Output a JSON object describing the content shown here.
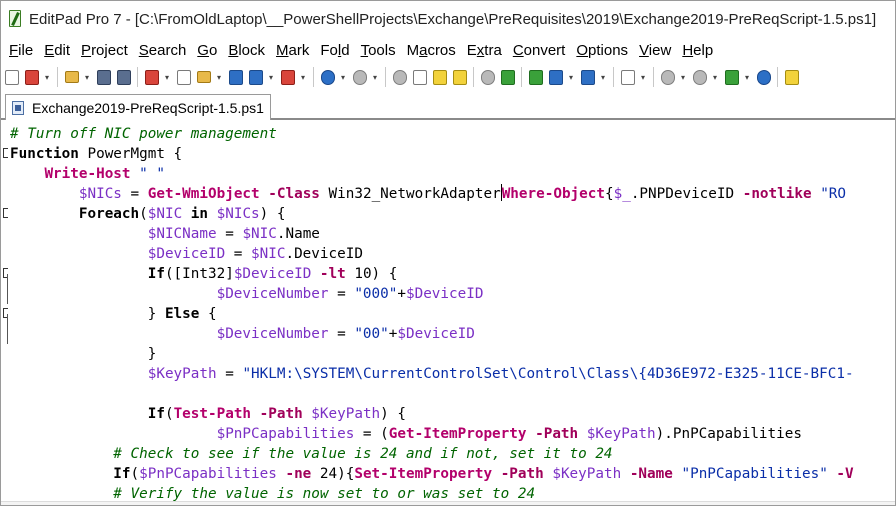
{
  "window": {
    "title": "EditPad Pro 7 - [C:\\FromOldLaptop\\__PowerShellProjects\\Exchange\\PreRequisites\\2019\\Exchange2019-PreReqScript-1.5.ps1]"
  },
  "menu": [
    {
      "first": "F",
      "rest": "ile"
    },
    {
      "first": "E",
      "rest": "dit"
    },
    {
      "first": "P",
      "rest": "roject"
    },
    {
      "first": "S",
      "rest": "earch"
    },
    {
      "first": "G",
      "rest": "o"
    },
    {
      "first": "B",
      "rest": "lock"
    },
    {
      "first": "M",
      "rest": "ark"
    },
    {
      "first": "Fo",
      "rest": "ld",
      "u": "l"
    },
    {
      "first": "T",
      "rest": "ools"
    },
    {
      "first": "M",
      "rest": "acros",
      "pre": "",
      "u2": "a"
    },
    {
      "first": "E",
      "rest": "xtra",
      "u": "x"
    },
    {
      "first": "C",
      "rest": "onvert"
    },
    {
      "first": "O",
      "rest": "ptions"
    },
    {
      "first": "V",
      "rest": "iew"
    },
    {
      "first": "H",
      "rest": "elp"
    }
  ],
  "menu_labels": [
    "File",
    "Edit",
    "Project",
    "Search",
    "Go",
    "Block",
    "Mark",
    "Fold",
    "Tools",
    "Macros",
    "Extra",
    "Convert",
    "Options",
    "View",
    "Help"
  ],
  "menu_underlines": [
    "F",
    "E",
    "P",
    "S",
    "G",
    "B",
    "M",
    "l",
    "T",
    "a",
    "x",
    "C",
    "O",
    "V",
    "H"
  ],
  "toolbar_icons": [
    "new-file-icon",
    "close-file-icon",
    "open-file-icon",
    "save-icon",
    "save-all-icon",
    "open-project-icon",
    "copy-files-icon",
    "folder-icon",
    "print-icon",
    "print-preview-icon",
    "delete-icon",
    "undo-icon",
    "redo-icon",
    "cut-icon",
    "copy-icon",
    "paste-icon",
    "clipboard-icon",
    "search-icon",
    "replace-icon",
    "indent-icon",
    "block-icon",
    "font-icon",
    "spellcheck-icon",
    "back-icon",
    "forward-icon",
    "bookmark-icon",
    "run-icon",
    "tools-icon"
  ],
  "tab": {
    "label": "Exchange2019-PreReqScript-1.5.ps1"
  },
  "code": [
    {
      "fold": "",
      "indent": "",
      "tokens": [
        [
          "comment",
          "# Turn off NIC power management"
        ]
      ]
    },
    {
      "fold": "box",
      "indent": "",
      "tokens": [
        [
          "kw",
          "Function"
        ],
        [
          "plain",
          " PowerMgmt {"
        ]
      ]
    },
    {
      "fold": "",
      "indent": "    ",
      "tokens": [
        [
          "cmd",
          "Write-Host"
        ],
        [
          "plain",
          " "
        ],
        [
          "str",
          "\" \""
        ]
      ]
    },
    {
      "fold": "",
      "indent": "        ",
      "tokens": [
        [
          "var",
          "$NICs"
        ],
        [
          "plain",
          " = "
        ],
        [
          "cmd",
          "Get-WmiObject"
        ],
        [
          "plain",
          " "
        ],
        [
          "op",
          "-Class"
        ],
        [
          "plain",
          " Win32_NetworkAdapter"
        ],
        [
          "caret",
          ""
        ],
        [
          "cmd",
          "Where-Object"
        ],
        [
          "plain",
          "{"
        ],
        [
          "var",
          "$_"
        ],
        [
          "plain",
          ".PNPDeviceID "
        ],
        [
          "op",
          "-notlike"
        ],
        [
          "plain",
          " "
        ],
        [
          "str",
          "\"RO"
        ]
      ]
    },
    {
      "fold": "box",
      "indent": "        ",
      "tokens": [
        [
          "kw",
          "Foreach"
        ],
        [
          "plain",
          "("
        ],
        [
          "var",
          "$NIC"
        ],
        [
          "plain",
          " "
        ],
        [
          "kw",
          "in"
        ],
        [
          "plain",
          " "
        ],
        [
          "var",
          "$NICs"
        ],
        [
          "plain",
          ") {"
        ]
      ]
    },
    {
      "fold": "",
      "indent": "                ",
      "tokens": [
        [
          "var",
          "$NICName"
        ],
        [
          "plain",
          " = "
        ],
        [
          "var",
          "$NIC"
        ],
        [
          "plain",
          ".Name"
        ]
      ]
    },
    {
      "fold": "",
      "indent": "                ",
      "tokens": [
        [
          "var",
          "$DeviceID"
        ],
        [
          "plain",
          " = "
        ],
        [
          "var",
          "$NIC"
        ],
        [
          "plain",
          ".DeviceID"
        ]
      ]
    },
    {
      "fold": "box",
      "indent": "                ",
      "tokens": [
        [
          "kw",
          "If"
        ],
        [
          "plain",
          "([Int32]"
        ],
        [
          "var",
          "$DeviceID"
        ],
        [
          "plain",
          " "
        ],
        [
          "op",
          "-lt"
        ],
        [
          "plain",
          " 10) {"
        ]
      ]
    },
    {
      "fold": "",
      "indent": "                        ",
      "tokens": [
        [
          "var",
          "$DeviceNumber"
        ],
        [
          "plain",
          " = "
        ],
        [
          "str",
          "\"000\""
        ],
        [
          "plain",
          "+"
        ],
        [
          "var",
          "$DeviceID"
        ]
      ]
    },
    {
      "fold": "box",
      "indent": "                ",
      "tokens": [
        [
          "plain",
          "} "
        ],
        [
          "kw",
          "Else"
        ],
        [
          "plain",
          " {"
        ]
      ]
    },
    {
      "fold": "",
      "indent": "                        ",
      "tokens": [
        [
          "var",
          "$DeviceNumber"
        ],
        [
          "plain",
          " = "
        ],
        [
          "str",
          "\"00\""
        ],
        [
          "plain",
          "+"
        ],
        [
          "var",
          "$DeviceID"
        ]
      ]
    },
    {
      "fold": "",
      "indent": "                ",
      "tokens": [
        [
          "plain",
          "}"
        ]
      ]
    },
    {
      "fold": "",
      "indent": "                ",
      "tokens": [
        [
          "var",
          "$KeyPath"
        ],
        [
          "plain",
          " = "
        ],
        [
          "str",
          "\"HKLM:\\SYSTEM\\CurrentControlSet\\Control\\Class\\{4D36E972-E325-11CE-BFC1-"
        ]
      ]
    },
    {
      "fold": "",
      "indent": "",
      "tokens": [
        [
          "plain",
          ""
        ]
      ]
    },
    {
      "fold": "",
      "indent": "                ",
      "tokens": [
        [
          "kw",
          "If"
        ],
        [
          "plain",
          "("
        ],
        [
          "cmd",
          "Test-Path"
        ],
        [
          "plain",
          " "
        ],
        [
          "op",
          "-Path"
        ],
        [
          "plain",
          " "
        ],
        [
          "var",
          "$KeyPath"
        ],
        [
          "plain",
          ") {"
        ]
      ]
    },
    {
      "fold": "",
      "indent": "                        ",
      "tokens": [
        [
          "var",
          "$PnPCapabilities"
        ],
        [
          "plain",
          " = ("
        ],
        [
          "cmd",
          "Get-ItemProperty"
        ],
        [
          "plain",
          " "
        ],
        [
          "op",
          "-Path"
        ],
        [
          "plain",
          " "
        ],
        [
          "var",
          "$KeyPath"
        ],
        [
          "plain",
          ").PnPCapabilities"
        ]
      ]
    },
    {
      "fold": "",
      "indent": "            ",
      "tokens": [
        [
          "comment",
          "# Check to see if the value is 24 and if not, set it to 24"
        ]
      ]
    },
    {
      "fold": "",
      "indent": "            ",
      "tokens": [
        [
          "kw",
          "If"
        ],
        [
          "plain",
          "("
        ],
        [
          "var",
          "$PnPCapabilities"
        ],
        [
          "plain",
          " "
        ],
        [
          "op",
          "-ne"
        ],
        [
          "plain",
          " 24){"
        ],
        [
          "cmd",
          "Set-ItemProperty"
        ],
        [
          "plain",
          " "
        ],
        [
          "op",
          "-Path"
        ],
        [
          "plain",
          " "
        ],
        [
          "var",
          "$KeyPath"
        ],
        [
          "plain",
          " "
        ],
        [
          "op",
          "-Name"
        ],
        [
          "plain",
          " "
        ],
        [
          "str",
          "\"PnPCapabilities\""
        ],
        [
          "plain",
          " "
        ],
        [
          "op",
          "-V"
        ]
      ]
    },
    {
      "fold": "",
      "indent": "            ",
      "tokens": [
        [
          "comment",
          "# Verify the value is now set to or was set to 24"
        ]
      ]
    }
  ]
}
